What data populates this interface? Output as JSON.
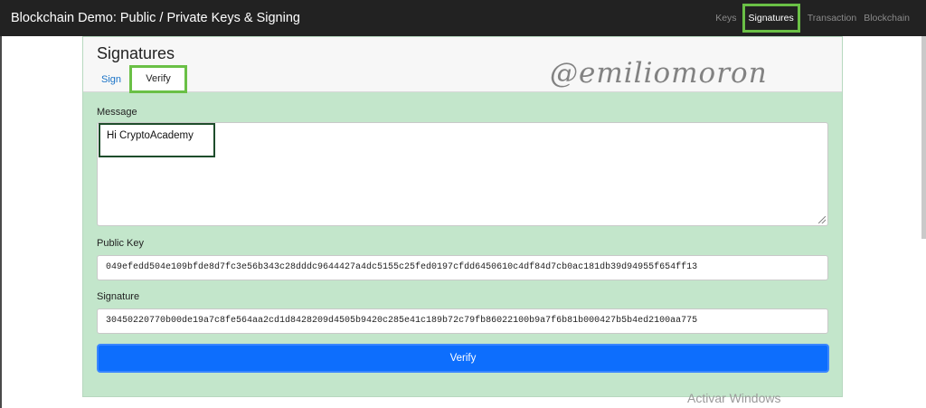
{
  "navbar": {
    "title": "Blockchain Demo: Public / Private Keys & Signing",
    "links": [
      {
        "label": "Keys",
        "active": false
      },
      {
        "label": "Signatures",
        "active": true
      },
      {
        "label": "Transaction",
        "active": false
      },
      {
        "label": "Blockchain",
        "active": false
      }
    ]
  },
  "panel": {
    "title": "Signatures",
    "tabs": [
      {
        "label": "Sign",
        "active": false
      },
      {
        "label": "Verify",
        "active": true
      }
    ]
  },
  "watermark": "@emiliomoron",
  "form": {
    "message_label": "Message",
    "message_value": "Hi CryptoAcademy",
    "public_key_label": "Public Key",
    "public_key_value": "049efedd504e109bfde8d7fc3e56b343c28dddc9644427a4dc5155c25fed0197cfdd6450610c4df84d7cb0ac181db39d94955f654ff13",
    "signature_label": "Signature",
    "signature_value": "30450220770b00de19a7c8fe564aa2cd1d8428209d4505b9420c285e41c189b72c79fb86022100b9a7f6b81b000427b5b4ed2100aa775",
    "verify_button": "Verify"
  },
  "os_overlay": "Activar Windows",
  "colors": {
    "navbar_bg": "#222222",
    "panel_bg": "#c3e6cb",
    "button_bg": "#0d6efd",
    "highlight": "#6ac046"
  }
}
